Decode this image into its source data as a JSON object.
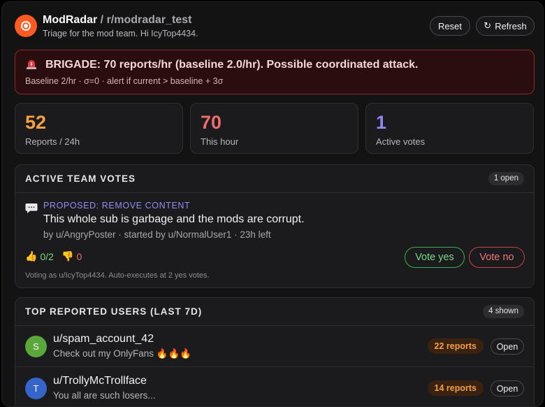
{
  "header": {
    "app_name": "ModRadar",
    "separator": " / ",
    "subreddit": "r/modradar_test",
    "subtitle": "Triage for the mod team. Hi IcyTop4434.",
    "reset_label": "Reset",
    "refresh_icon": "↻",
    "refresh_label": "Refresh"
  },
  "alert": {
    "icon": "siren-icon",
    "title": "BRIGADE: 70 reports/hr (baseline 2.0/hr). Possible coordinated attack.",
    "detail": "Baseline 2/hr · σ=0 · alert if current > baseline + 3σ"
  },
  "stats": [
    {
      "value": "52",
      "label": "Reports / 24h",
      "color": "#f5a142"
    },
    {
      "value": "70",
      "label": "This hour",
      "color": "#f06b6b"
    },
    {
      "value": "1",
      "label": "Active votes",
      "color": "#8a8af0"
    }
  ],
  "votes": {
    "title": "ACTIVE TEAM VOTES",
    "badge": "1 open",
    "item": {
      "icon": "speech-bubble-icon",
      "kicker": "PROPOSED: REMOVE CONTENT",
      "content": "This whole sub is garbage and the mods are corrupt.",
      "meta": "by u/AngryPoster · started by u/NormalUser1 · 23h left",
      "yes_icon": "👍",
      "yes_tally": "0/2",
      "no_icon": "👎",
      "no_tally": "0",
      "vote_yes_label": "Vote yes",
      "vote_no_label": "Vote no",
      "footer": "Voting as u/IcyTop4434. Auto-executes at 2 yes votes."
    }
  },
  "users": {
    "title": "TOP REPORTED USERS (LAST 7D)",
    "badge": "4 shown",
    "rows": [
      {
        "initial": "S",
        "avatar_color": "#5aa83b",
        "name": "u/spam_account_42",
        "snippet": "Check out my OnlyFans 🔥🔥🔥",
        "reports": "22 reports",
        "open_label": "Open"
      },
      {
        "initial": "T",
        "avatar_color": "#3565c9",
        "name": "u/TrollyMcTrollface",
        "snippet": "You all are such losers...",
        "reports": "14 reports",
        "open_label": "Open"
      }
    ]
  }
}
